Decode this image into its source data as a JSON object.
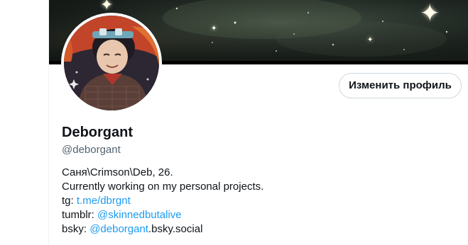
{
  "colors": {
    "text_primary": "#0f1419",
    "text_secondary": "#536471",
    "link": "#1d9bf0",
    "button_border": "#cfd9de"
  },
  "header": {
    "banner_icon": "starry-banner-image",
    "avatar_icon": "profile-avatar-illustration"
  },
  "profile": {
    "edit_button_label": "Изменить профиль",
    "display_name": "Deborgant",
    "handle": "@deborgant"
  },
  "bio": {
    "line1": "Саня\\Crimson\\Deb, 26.",
    "line2": "Currently working on my personal projects.",
    "tg_prefix": "tg: ",
    "tg_link": "t.me/dbrgnt",
    "tumblr_prefix": "tumblr: ",
    "tumblr_link": "@skinnedbutalive",
    "bsky_prefix": "bsky: ",
    "bsky_link": "@deborgant",
    "bsky_suffix": ".bsky.social"
  }
}
